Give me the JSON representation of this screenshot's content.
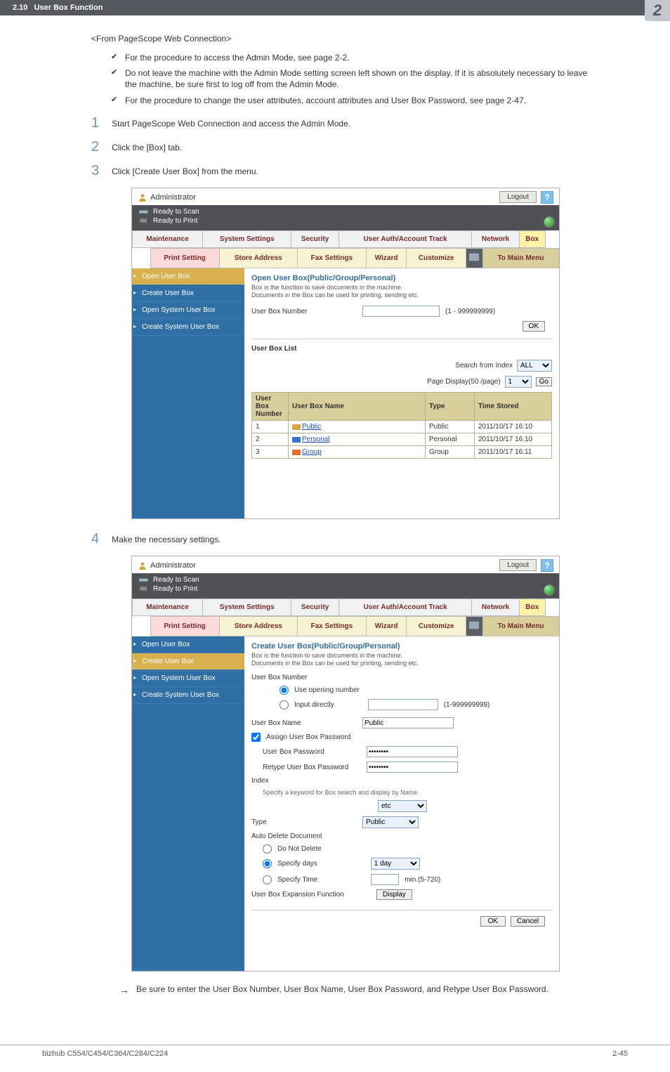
{
  "header": {
    "section": "2.10",
    "title": "User Box Function",
    "badge": "2"
  },
  "intro": "<From PageScope Web Connection>",
  "bullets": [
    "For the procedure to access the Admin Mode, see page 2-2.",
    "Do not leave the machine with the Admin Mode setting screen left shown on the display. If it is absolutely necessary to leave the machine, be sure first to log off from the Admin Mode.",
    "For the procedure to change the user attributes, account attributes and User Box Password, see page 2-47."
  ],
  "steps": {
    "s1": "Start PageScope Web Connection and access the Admin Mode.",
    "s2": "Click the [Box] tab.",
    "s3": "Click [Create User Box] from the menu.",
    "s4": "Make the necessary settings."
  },
  "ui": {
    "role": "Administrator",
    "logout": "Logout",
    "status": {
      "scan": "Ready to Scan",
      "print": "Ready to Print"
    },
    "tabs": [
      "Maintenance",
      "System Settings",
      "Security",
      "User Auth/Account Track",
      "Network",
      "Box"
    ],
    "subtabs": {
      "a": "Print Setting",
      "b": "Store Address",
      "c": "Fax Settings",
      "d": "Wizard",
      "e": "Customize",
      "f": "To Main Menu"
    },
    "menu": [
      "Open User Box",
      "Create User Box",
      "Open System User Box",
      "Create System User Box"
    ]
  },
  "panel1": {
    "title": "Open User Box(Public/Group/Personal)",
    "desc1": "Box is the function to save documents in the machine.",
    "desc2": "Documents in the Box can be used for printing, sending etc.",
    "numlabel": "User Box Number",
    "range": "(1 - 999999999)",
    "ok": "OK",
    "listtitle": "User Box List",
    "search": "Search from Index",
    "all": "ALL",
    "pageper": "Page Display(50 /page)",
    "pagesel": "1",
    "go": "Go",
    "cols": {
      "num": "Number",
      "name": "User Box Name",
      "type": "Type",
      "time": "Time Stored",
      "boxlbl": "User Box"
    },
    "rows": [
      {
        "n": "1",
        "name": "Public",
        "type": "Public",
        "time": "2011/10/17 16:10",
        "color": "#d8a63a"
      },
      {
        "n": "2",
        "name": "Personal",
        "type": "Personal",
        "time": "2011/10/17 16:10",
        "color": "#3a74c8"
      },
      {
        "n": "3",
        "name": "Group",
        "type": "Group",
        "time": "2011/10/17 16:11",
        "color": "#e07030"
      }
    ]
  },
  "panel2": {
    "title": "Create User Box(Public/Group/Personal)",
    "desc1": "Box is the function to save documents in the machine.",
    "desc2": "Documents in the Box can be used for printing, sending etc.",
    "num": "User Box Number",
    "useopen": "Use opening number",
    "inputdir": "Input directly",
    "range": "(1-999999999)",
    "name": "User Box Name",
    "nameval": "Public",
    "assignchk": "Assign User Box Password",
    "pw": "User Box Password",
    "rpw": "Retype User Box Password",
    "pwval": "●●●●●●●●",
    "index": "Index",
    "idxhint": "Specify a keyword for Box search and display by Name.",
    "idxsel": "etc",
    "type": "Type",
    "typesel": "Public",
    "adoc": "Auto Delete Document",
    "dnd": "Do Not Delete",
    "spdays": "Specify days",
    "daysel": "1 day",
    "sptime": "Specify Time",
    "timerange": "min.(5-720)",
    "expfn": "User Box Expansion Function",
    "dispbtn": "Display",
    "ok": "OK",
    "cancel": "Cancel"
  },
  "note": "Be sure to enter the User Box Number, User Box Name, User Box Password, and Retype User Box Password.",
  "footer": {
    "model": "bizhub C554/C454/C364/C284/C224",
    "page": "2-45"
  }
}
